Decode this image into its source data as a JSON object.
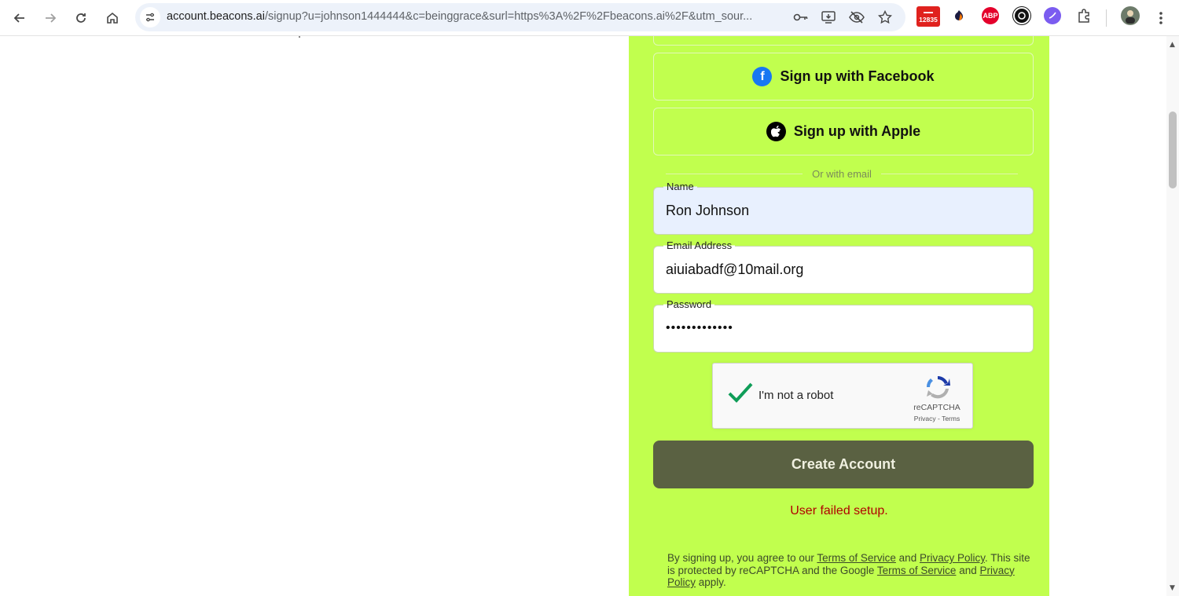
{
  "browser": {
    "url_main": "account.beacons.ai",
    "url_rest": "/signup?u=johnson1444444&c=beinggrace&surl=https%3A%2F%2Fbeacons.ai%2F&utm_sour...",
    "badge_count": "12835",
    "ext_abp": "ABP"
  },
  "signup": {
    "facebook_label": "Sign up with Facebook",
    "apple_label": "Sign up with Apple",
    "divider_text": "Or with email",
    "name": {
      "label": "Name",
      "value": "Ron Johnson"
    },
    "email": {
      "label": "Email Address",
      "value": "aiuiabadf@10mail.org"
    },
    "password": {
      "label": "Password",
      "value": "•••••••••••••"
    },
    "captcha": {
      "label": "I'm not a robot",
      "brand": "reCAPTCHA",
      "privacy": "Privacy",
      "sep": " - ",
      "terms": "Terms"
    },
    "create_label": "Create Account",
    "error_text": "User failed setup."
  },
  "legal": {
    "p1": "By signing up, you agree to our ",
    "tos1": "Terms of Service",
    "and1": " and ",
    "pp1": "Privacy Policy",
    "p2": ". This site is protected by reCAPTCHA and the Google ",
    "tos2": "Terms of Service",
    "and2": " and ",
    "pp2": "Privacy Policy",
    "p3": " apply."
  },
  "colors": {
    "panel": "#c1ff4e",
    "create_button": "#5a6142",
    "error": "#b00000"
  }
}
